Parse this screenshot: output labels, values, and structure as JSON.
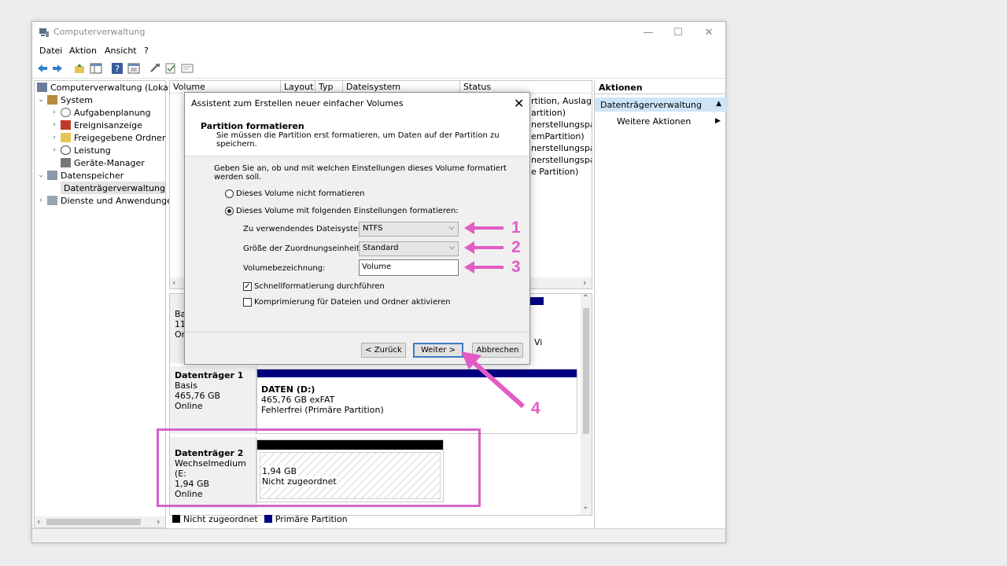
{
  "window": {
    "title": "Computerverwaltung",
    "controls": {
      "minimize": "—",
      "maximize": "☐",
      "close": "✕"
    }
  },
  "menu": [
    "Datei",
    "Aktion",
    "Ansicht",
    "?"
  ],
  "tree": {
    "items": [
      {
        "label": "Computerverwaltung (Lokal)",
        "icon": "computer-icon"
      },
      {
        "label": "System",
        "icon": "tools-icon"
      },
      {
        "label": "Aufgabenplanung",
        "icon": "clock-icon"
      },
      {
        "label": "Ereignisanzeige",
        "icon": "event-viewer-icon"
      },
      {
        "label": "Freigegebene Ordner",
        "icon": "shared-folder-icon"
      },
      {
        "label": "Leistung",
        "icon": "performance-icon"
      },
      {
        "label": "Geräte-Manager",
        "icon": "device-manager-icon"
      },
      {
        "label": "Datenspeicher",
        "icon": "storage-icon"
      },
      {
        "label": "Datenträgerverwaltung",
        "icon": "disk-management-icon"
      },
      {
        "label": "Dienste und Anwendungen",
        "icon": "services-icon"
      }
    ]
  },
  "volumes": {
    "columns": [
      "Volume",
      "Layout",
      "Typ",
      "Dateisystem",
      "Status"
    ],
    "status_fragments": [
      "rtition, Auslagen",
      "artition)",
      "nerstellungsparti",
      "emPartition)",
      "nerstellungsparti",
      "nerstellungsparti",
      "e Partition)"
    ]
  },
  "disks": {
    "disk0": {
      "line1": "Bas",
      "line2": "119",
      "line3": "On",
      "fragment": "Vi"
    },
    "disk1": {
      "name": "Datenträger 1",
      "type": "Basis",
      "size": "465,76 GB",
      "state": "Online",
      "partition": {
        "title": "DATEN  (D:)",
        "size_fs": "465,76 GB exFAT",
        "status": "Fehlerfrei (Primäre Partition)"
      }
    },
    "disk2": {
      "name": "Datenträger 2",
      "type": "Wechselmedium (E:",
      "size": "1,94 GB",
      "state": "Online",
      "partition": {
        "size": "1,94 GB",
        "status": "Nicht zugeordnet"
      }
    }
  },
  "legend": {
    "unallocated": "Nicht zugeordnet",
    "primary": "Primäre Partition",
    "unallocated_color": "#000000",
    "primary_color": "#000080"
  },
  "actions": {
    "title": "Aktionen",
    "section": "Datenträgerverwaltung",
    "more": "Weitere Aktionen"
  },
  "dialog": {
    "title": "Assistent zum Erstellen neuer einfacher Volumes",
    "header_title": "Partition formatieren",
    "header_subtitle": "Sie müssen die Partition erst formatieren, um Daten auf der Partition zu speichern.",
    "intro": "Geben Sie an, ob und mit welchen Einstellungen dieses Volume formatiert werden soll.",
    "radio_no_format": "Dieses Volume nicht formatieren",
    "radio_format": "Dieses Volume mit folgenden Einstellungen formatieren:",
    "fs_label": "Zu verwendendes Dateisystem:",
    "fs_value": "NTFS",
    "alloc_label": "Größe der Zuordnungseinheit:",
    "alloc_value": "Standard",
    "volname_label": "Volumebezeichnung:",
    "volname_value": "Volume",
    "quick_format": "Schnellformatierung durchführen",
    "compression": "Komprimierung für Dateien und Ordner aktivieren",
    "back": "< Zurück",
    "next": "Weiter >",
    "cancel": "Abbrechen"
  },
  "annotations": {
    "n1": "1",
    "n2": "2",
    "n3": "3",
    "n4": "4",
    "color": "#e25cc5"
  }
}
